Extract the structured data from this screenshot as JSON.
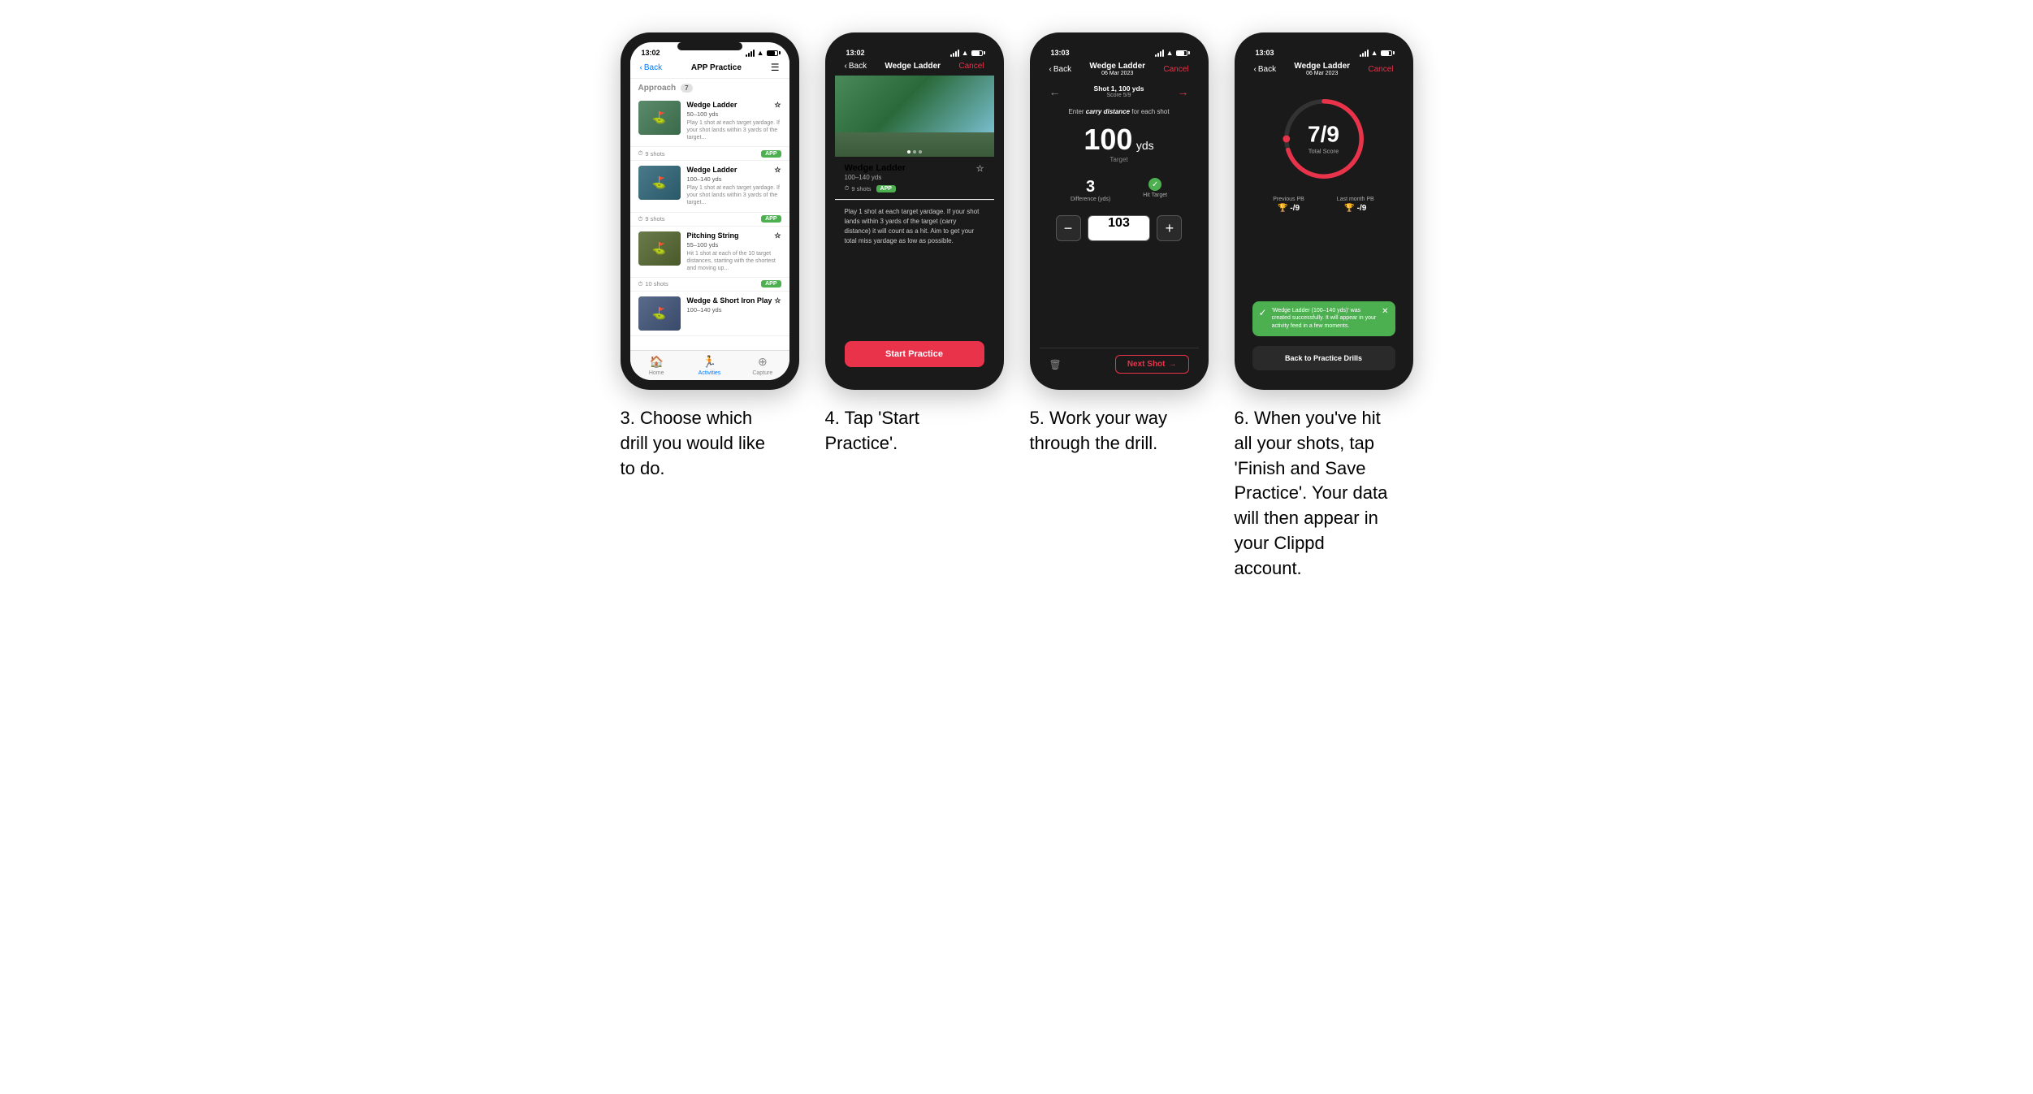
{
  "page": {
    "background": "#ffffff"
  },
  "phones": [
    {
      "id": "phone1",
      "time": "13:02",
      "nav": {
        "back": "Back",
        "title": "APP Practice",
        "action": "☰"
      },
      "section": {
        "label": "Approach",
        "count": "7"
      },
      "drills": [
        {
          "name": "Wedge Ladder",
          "range": "50–100 yds",
          "desc": "Play 1 shot at each target yardage. If your shot lands within 3 yards of the target...",
          "shots": "9 shots",
          "badge": "APP"
        },
        {
          "name": "Wedge Ladder",
          "range": "100–140 yds",
          "desc": "Play 1 shot at each target yardage. If your shot lands within 3 yards of the target...",
          "shots": "9 shots",
          "badge": "APP"
        },
        {
          "name": "Pitching String",
          "range": "55–100 yds",
          "desc": "Hit 1 shot at each of the 10 target distances, starting with the shortest and moving up...",
          "shots": "10 shots",
          "badge": "APP"
        },
        {
          "name": "Wedge & Short Iron Play",
          "range": "100–140 yds",
          "desc": "",
          "shots": "",
          "badge": ""
        }
      ],
      "bottomNav": [
        {
          "icon": "🏠",
          "label": "Home",
          "active": false
        },
        {
          "icon": "🏃",
          "label": "Activities",
          "active": true
        },
        {
          "icon": "➕",
          "label": "Capture",
          "active": false
        }
      ]
    },
    {
      "id": "phone2",
      "time": "13:02",
      "nav": {
        "back": "Back",
        "title": "Wedge Ladder",
        "action": "Cancel"
      },
      "drill": {
        "name": "Wedge Ladder",
        "range": "100–140 yds",
        "shots": "9 shots",
        "badge": "APP",
        "desc": "Play 1 shot at each target yardage. If your shot lands within 3 yards of the target (carry distance) it will count as a hit. Aim to get your total miss yardage as low as possible."
      },
      "startButton": "Start Practice"
    },
    {
      "id": "phone3",
      "time": "13:03",
      "nav": {
        "back": "Back",
        "title": "Wedge Ladder",
        "subtitle": "06 Mar 2023",
        "action": "Cancel"
      },
      "shot": {
        "number": "Shot 1, 100 yds",
        "score": "Score 5/9"
      },
      "carryLabel": "Enter carry distance for each shot",
      "target": {
        "value": "100",
        "unit": "yds",
        "label": "Target"
      },
      "stats": {
        "difference": "3",
        "differenceLabel": "Difference (yds)",
        "hitTarget": "Hit Target"
      },
      "input": {
        "value": "103"
      },
      "nextShot": "Next Shot"
    },
    {
      "id": "phone4",
      "time": "13:03",
      "nav": {
        "back": "Back",
        "title": "Wedge Ladder",
        "subtitle": "06 Mar 2023",
        "action": "Cancel"
      },
      "score": {
        "current": "7",
        "total": "9",
        "label": "Total Score"
      },
      "pbs": [
        {
          "label": "Previous PB",
          "value": "-/9"
        },
        {
          "label": "Last month PB",
          "value": "-/9"
        }
      ],
      "toast": {
        "text": "'Wedge Ladder (100–140 yds)' was created successfully. It will appear in your activity feed in a few moments."
      },
      "backButton": "Back to Practice Drills"
    }
  ],
  "captions": [
    "3. Choose which drill you would like to do.",
    "4. Tap 'Start Practice'.",
    "5. Work your way through the drill.",
    "6. When you've hit all your shots, tap 'Finish and Save Practice'. Your data will then appear in your Clippd account."
  ]
}
